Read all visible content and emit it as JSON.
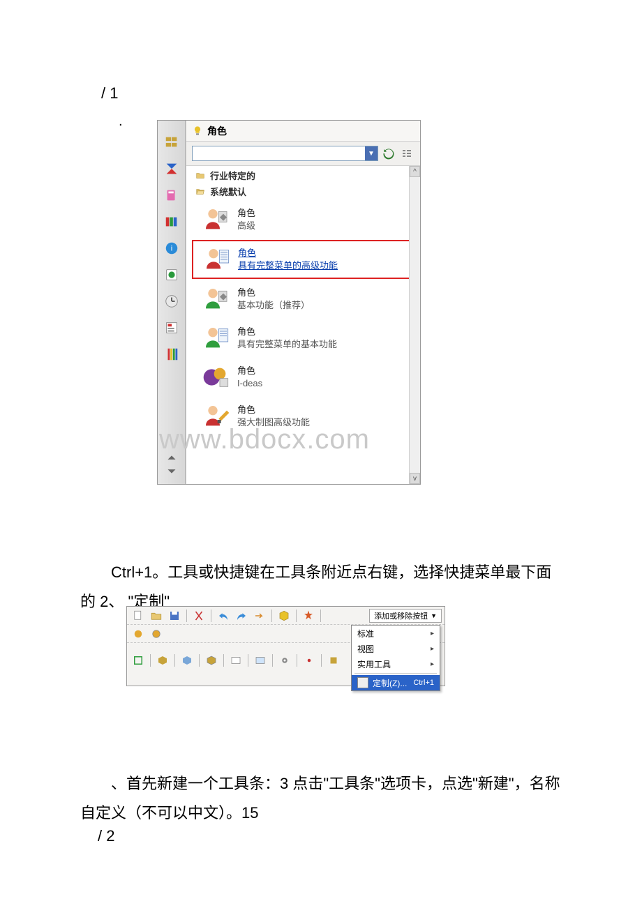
{
  "text": {
    "top": "/ 1",
    "ctrl_para": "Ctrl+1。工具或快捷键在工具条附近点右键，选择快捷菜单最下面的 2、 \"定制\"",
    "step3": "、首先新建一个工具条：3 点击\"工具条\"选项卡，点选\"新建\"，名称自定义（不可以中文）。15",
    "bottom": "/ 2"
  },
  "roles_panel": {
    "title": "角色",
    "categories": [
      "行业特定的",
      "系统默认"
    ],
    "items": [
      {
        "title": "角色",
        "desc": "高级"
      },
      {
        "title": "角色",
        "desc": "具有完整菜单的高级功能",
        "selected": true
      },
      {
        "title": "角色",
        "desc": "基本功能（推荐）"
      },
      {
        "title": "角色",
        "desc": "具有完整菜单的基本功能"
      },
      {
        "title": "角色",
        "desc": "I-deas"
      },
      {
        "title": "角色",
        "desc": "强大制图高级功能"
      }
    ]
  },
  "tb": {
    "add_remove": "添加或移除按钮",
    "menu": [
      {
        "label": "标准",
        "sub": true
      },
      {
        "label": "视图",
        "sub": true
      },
      {
        "label": "实用工具",
        "sub": true
      }
    ],
    "customize": {
      "label": "定制(Z)...",
      "shortcut": "Ctrl+1"
    }
  },
  "watermark": "www.bdocx.com"
}
